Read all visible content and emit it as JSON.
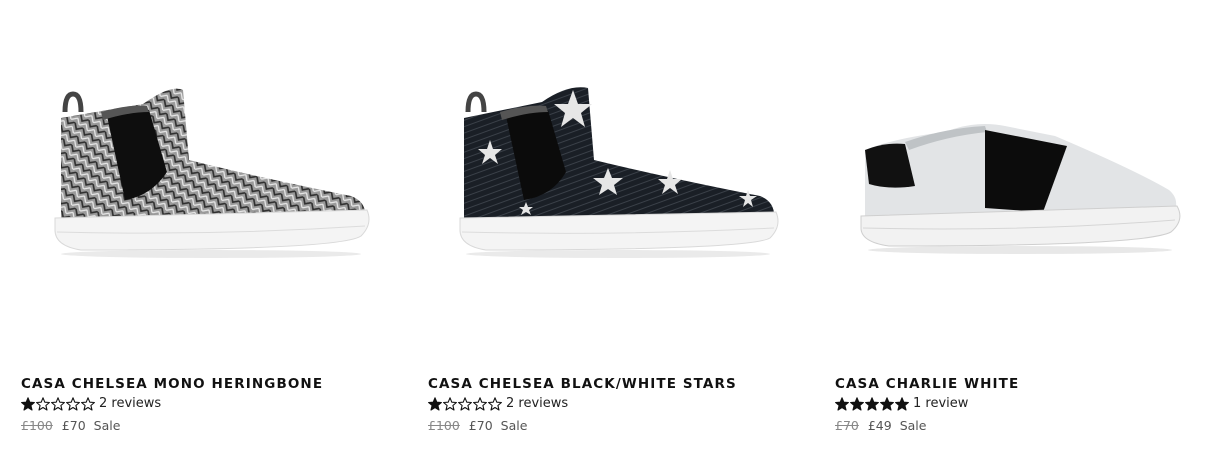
{
  "products": [
    {
      "name": "CASA CHELSEA MONO HERINGBONE",
      "rating": 1,
      "max_rating": 5,
      "reviews": "2 reviews",
      "price_was": "£100",
      "price_now": "£70",
      "sale_label": "Sale"
    },
    {
      "name": "CASA CHELSEA BLACK/WHITE STARS",
      "rating": 1,
      "max_rating": 5,
      "reviews": "2 reviews",
      "price_was": "£100",
      "price_now": "£70",
      "sale_label": "Sale"
    },
    {
      "name": "CASA CHARLIE WHITE",
      "rating": 5,
      "max_rating": 5,
      "reviews": "1 review",
      "price_was": "£70",
      "price_now": "£49",
      "sale_label": "Sale"
    }
  ]
}
